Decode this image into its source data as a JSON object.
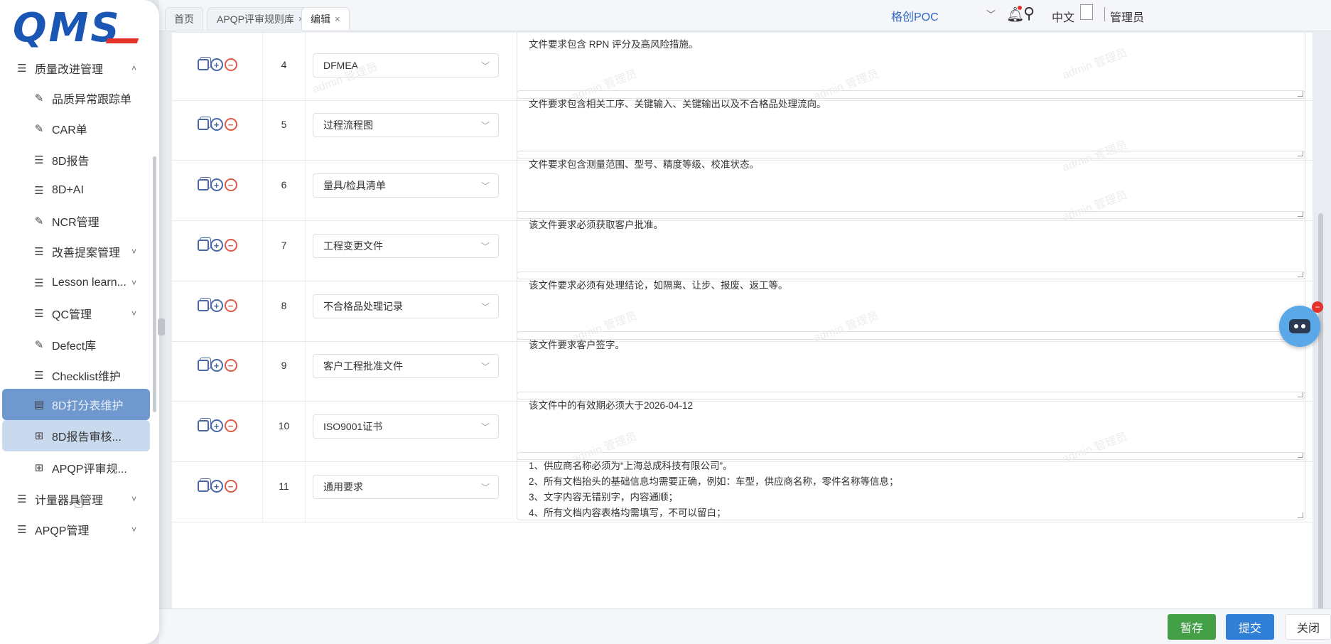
{
  "app": {
    "logo_text": "QMS"
  },
  "sidebar": {
    "items": [
      {
        "label": "质量改进管理",
        "icon": "list-icon",
        "chevron": "˄",
        "level": "top"
      },
      {
        "label": "品质异常跟踪单",
        "icon": "edit-icon",
        "level": "sub"
      },
      {
        "label": "CAR单",
        "icon": "edit-icon",
        "level": "sub"
      },
      {
        "label": "8D报告",
        "icon": "list-icon",
        "level": "sub"
      },
      {
        "label": "8D+AI",
        "icon": "list-icon",
        "level": "sub"
      },
      {
        "label": "NCR管理",
        "icon": "edit-icon",
        "level": "sub"
      },
      {
        "label": "改善提案管理",
        "icon": "list-icon",
        "chevron": "˅",
        "level": "sub"
      },
      {
        "label": "Lesson learn...",
        "icon": "list-icon",
        "chevron": "˅",
        "level": "sub"
      },
      {
        "label": "QC管理",
        "icon": "list-icon",
        "chevron": "˅",
        "level": "sub"
      },
      {
        "label": "Defect库",
        "icon": "edit-icon",
        "level": "sub"
      },
      {
        "label": "Checklist维护",
        "icon": "list-icon",
        "level": "sub"
      },
      {
        "label": "8D打分表维护",
        "icon": "form-icon",
        "level": "sub",
        "state": "active"
      },
      {
        "label": "8D报告审核...",
        "icon": "table-icon",
        "level": "sub",
        "state": "hover"
      },
      {
        "label": "APQP评审规...",
        "icon": "table-icon",
        "level": "sub"
      },
      {
        "label": "计量器具管理",
        "icon": "list-icon",
        "chevron": "˅",
        "level": "top"
      },
      {
        "label": "APQP管理",
        "icon": "list-icon",
        "chevron": "˅",
        "level": "top"
      }
    ]
  },
  "tabs": [
    {
      "label": "首页",
      "closable": false
    },
    {
      "label": "APQP评审规则库",
      "closable": true
    },
    {
      "label": "编辑",
      "closable": true,
      "active": true
    }
  ],
  "header": {
    "company": "格创POC",
    "language": "中文",
    "user": "管理员"
  },
  "watermark": "admin 管理员",
  "rows": [
    {
      "no": "4",
      "doc_type": "DFMEA",
      "requirement": "文件要求包含 RPN 评分及高风险措施。"
    },
    {
      "no": "5",
      "doc_type": "过程流程图",
      "requirement": "文件要求包含相关工序、关键输入、关键输出以及不合格品处理流向。"
    },
    {
      "no": "6",
      "doc_type": "量具/检具清单",
      "requirement": "文件要求包含测量范围、型号、精度等级、校准状态。"
    },
    {
      "no": "7",
      "doc_type": "工程变更文件",
      "requirement": "该文件要求必须获取客户批准。"
    },
    {
      "no": "8",
      "doc_type": "不合格品处理记录",
      "requirement": "该文件要求必须有处理结论，如隔离、让步、报废、返工等。"
    },
    {
      "no": "9",
      "doc_type": "客户工程批准文件",
      "requirement": "该文件要求客户签字。"
    },
    {
      "no": "10",
      "doc_type": "ISO9001证书",
      "requirement": "该文件中的有效期必须大于2026-04-12"
    },
    {
      "no": "11",
      "doc_type": "通用要求",
      "requirement": "1、供应商名称必须为“上海总成科技有限公司”。\n2、所有文档抬头的基础信息均需要正确，例如：车型，供应商名称，零件名称等信息；\n3、文字内容无错别字，内容通顺；\n4、所有文档内容表格均需填写，不可以留白；"
    }
  ],
  "footer": {
    "save_label": "暂存",
    "submit_label": "提交",
    "close_label": "关闭"
  },
  "colors": {
    "brand": "#1a56b4",
    "accent_red": "#e4322b",
    "save": "#43a047",
    "submit": "#2f7fd6",
    "active_nav": "#6f98cf"
  }
}
